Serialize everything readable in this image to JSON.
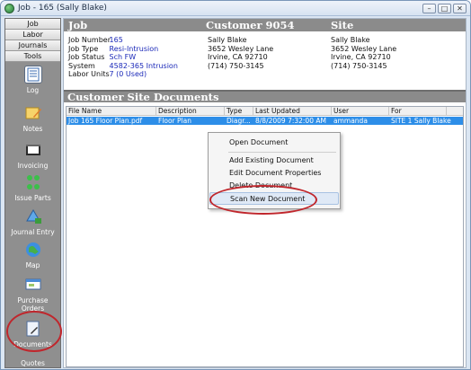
{
  "window": {
    "title": "Job - 165 (Sally Blake)",
    "controls": [
      "–",
      "□",
      "✕"
    ]
  },
  "sidebar": {
    "tabs": [
      "Job",
      "Labor",
      "Journals",
      "Tools"
    ],
    "items": [
      {
        "label": "Log",
        "icon": "log-icon"
      },
      {
        "label": "Notes",
        "icon": "notes-icon"
      },
      {
        "label": "Invoicing",
        "icon": "invoicing-icon"
      },
      {
        "label": "Issue Parts",
        "icon": "issue-parts-icon"
      },
      {
        "label": "Journal Entry",
        "icon": "journal-entry-icon"
      },
      {
        "label": "Map",
        "icon": "map-icon"
      },
      {
        "label": "Purchase Orders",
        "icon": "purchase-orders-icon"
      },
      {
        "label": "Documents",
        "icon": "documents-icon"
      },
      {
        "label": "Quotes",
        "icon": "quotes-icon"
      }
    ]
  },
  "headers": {
    "job": "Job",
    "customer": "Customer 9054",
    "site": "Site"
  },
  "job": {
    "rows": [
      {
        "label": "Job Number",
        "value": "165"
      },
      {
        "label": "Job Type",
        "value": "Resi-Intrusion"
      },
      {
        "label": "Job Status",
        "value": "Sch FW"
      },
      {
        "label": "System",
        "value": "4582-365 Intrusion"
      },
      {
        "label": "Labor Units",
        "value": "7 (0 Used)"
      }
    ]
  },
  "customer": {
    "lines": [
      "Sally Blake",
      "3652 Wesley Lane",
      "Irvine, CA  92710",
      "(714) 750-3145"
    ]
  },
  "site": {
    "lines": [
      "Sally Blake",
      "3652 Wesley Lane",
      "Irvine, CA  92710",
      "(714) 750-3145"
    ]
  },
  "documents": {
    "title": "Customer Site Documents",
    "columns": [
      "File Name",
      "Description",
      "Type",
      "Last Updated",
      "User",
      "For"
    ],
    "rows": [
      [
        "Job 165 Floor Plan.pdf",
        "Floor Plan",
        "Diagr...",
        "8/8/2009 7:32:00 AM",
        "ammanda",
        "SITE 1 Sally Blake"
      ]
    ]
  },
  "context_menu": {
    "items": [
      "Open Document",
      "Add Existing Document",
      "Edit Document Properties",
      "Delete Document",
      "Scan New Document"
    ],
    "highlighted": "Scan New Document"
  },
  "colors": {
    "accent_red": "#c0262c",
    "selection_blue": "#2d8ee8",
    "link_blue": "#1a28b8",
    "header_gray": "#8b8b8b"
  }
}
